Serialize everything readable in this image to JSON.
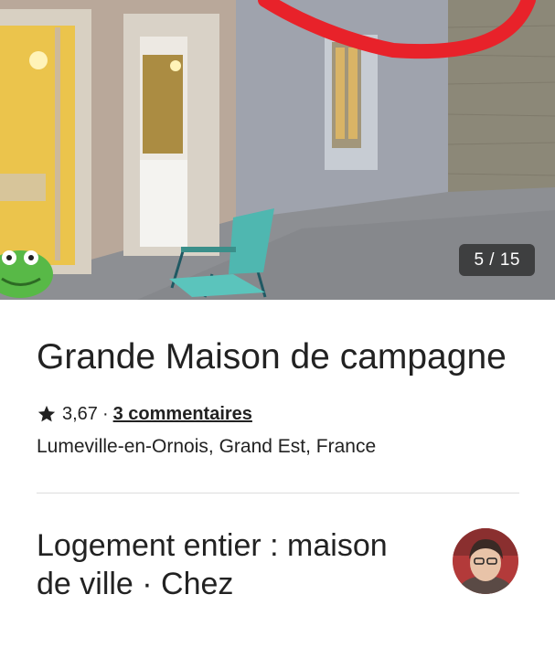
{
  "gallery": {
    "counter": "5 / 15",
    "image_description": "photo-courtyard-house"
  },
  "listing": {
    "title": "Grande Maison de campagne",
    "rating": "3,67",
    "separator": "·",
    "reviews_link": "3 commentaires",
    "location": "Lumeville-en-Ornois, Grand Est, France"
  },
  "host_section": {
    "heading": "Logement entier : maison de ville · Chez"
  },
  "icons": {
    "rating": "star-icon"
  }
}
